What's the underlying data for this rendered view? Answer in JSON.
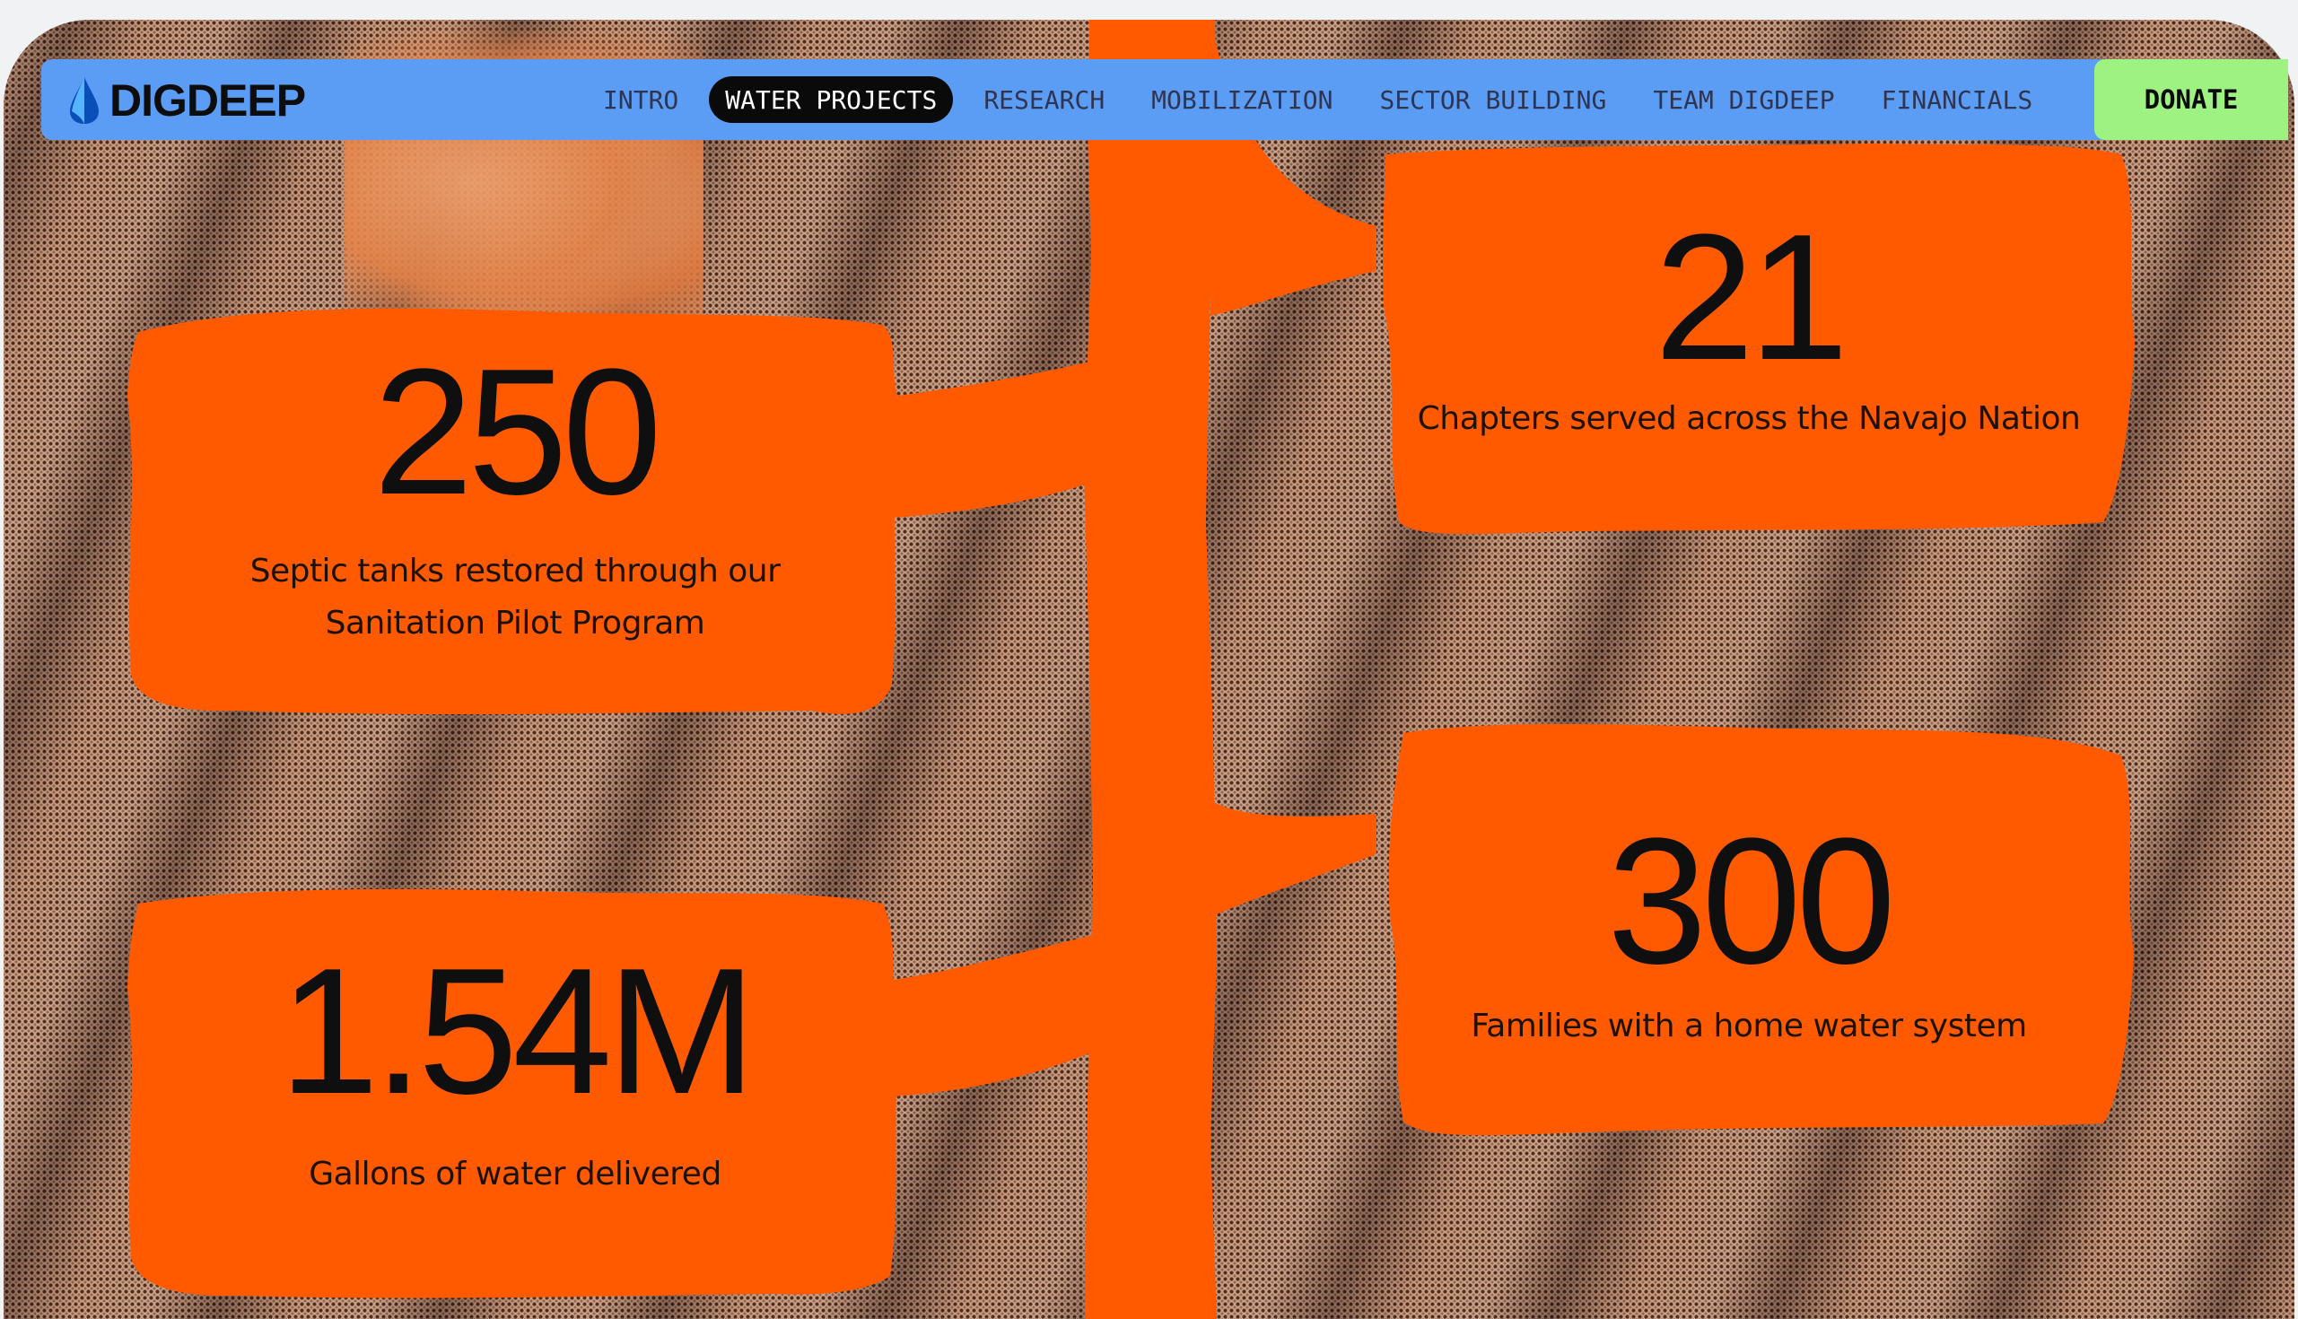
{
  "brand": {
    "name": "DIGDEEP",
    "logo_icon": "water-drop-icon"
  },
  "nav": {
    "items": [
      {
        "label": "INTRO"
      },
      {
        "label": "WATER PROJECTS",
        "active": true
      },
      {
        "label": "RESEARCH"
      },
      {
        "label": "MOBILIZATION"
      },
      {
        "label": "SECTOR BUILDING"
      },
      {
        "label": "TEAM DIGDEEP"
      },
      {
        "label": "FINANCIALS"
      }
    ],
    "donate_label": "DONATE"
  },
  "stats": [
    {
      "value": "250",
      "label_lines": [
        "Septic tanks restored through our",
        "Sanitation Pilot Program"
      ]
    },
    {
      "value": "21",
      "label_lines": [
        "Chapters served across the Navajo Nation"
      ]
    },
    {
      "value": "300",
      "label_lines": [
        "Families with a home water system"
      ]
    },
    {
      "value": "1.54M",
      "label_lines": [
        "Gallons of water delivered"
      ]
    }
  ],
  "colors": {
    "accent_orange": "#ff5a00",
    "nav_blue": "#5b9cf5",
    "donate_green": "#9ef281",
    "active_pill": "#0a0a0a",
    "text": "#111111"
  }
}
